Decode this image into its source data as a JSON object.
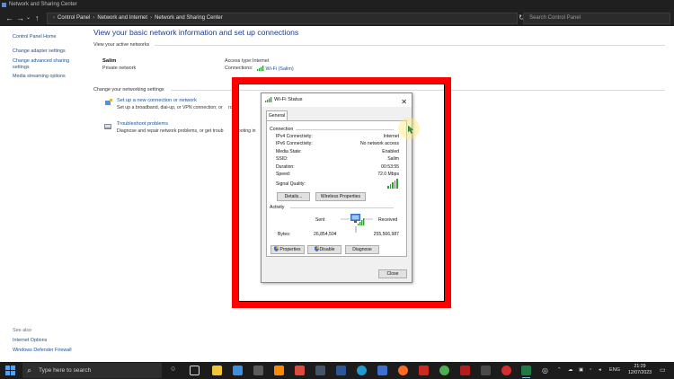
{
  "window": {
    "title": "Network and Sharing Center"
  },
  "address_bar": {
    "crumbs": [
      "Control Panel",
      "Network and Internet",
      "Network and Sharing Center"
    ],
    "search_placeholder": "Search Control Panel"
  },
  "left_pane": {
    "items": [
      "Control Panel Home",
      "Change adapter settings",
      "Change advanced sharing settings",
      "Media streaming options"
    ],
    "see_also_label": "See also",
    "see_also": [
      "Internet Options",
      "Windows Defender Firewall"
    ]
  },
  "main": {
    "title": "View your basic network information and set up connections",
    "active_networks_label": "View your active networks",
    "network_name": "Salim",
    "network_type": "Private network",
    "access_type_label": "Access type:",
    "access_type_value": "Internet",
    "connections_label": "Connections:",
    "connections_value": "Wi-Fi (Salim)",
    "change_settings_label": "Change your networking settings",
    "tasks": [
      {
        "link": "Set up a new connection or network",
        "desc": "Set up a broadband, dial-up, or VPN connection; or"
      },
      {
        "link": "Troubleshoot problems",
        "desc": "Diagnose and repair network problems, or get troub"
      }
    ],
    "tasks_overflow": [
      "ro",
      "hooting in"
    ]
  },
  "dialog": {
    "title": "Wi-Fi Status",
    "close_glyph": "✕",
    "tab": "General",
    "connection_label": "Connection",
    "rows": [
      {
        "label": "IPv4 Connectivity:",
        "value": "Internet"
      },
      {
        "label": "IPv6 Connectivity:",
        "value": "No network access"
      },
      {
        "label": "Media State:",
        "value": "Enabled"
      },
      {
        "label": "SSID:",
        "value": "Salim"
      },
      {
        "label": "Duration:",
        "value": "00:53:55"
      },
      {
        "label": "Speed:",
        "value": "72.0 Mbps"
      }
    ],
    "signal_label": "Signal Quality:",
    "signal_bars_lit": 5,
    "details_button": "Details...",
    "wireless_props_button": "Wireless Properties",
    "activity_label": "Activity",
    "sent_label": "Sent",
    "received_label": "Received",
    "bytes_label": "Bytes:",
    "bytes_sent": "26,854,504",
    "bytes_received": "255,566,987",
    "properties_button": "Properties",
    "disable_button": "Disable",
    "diagnose_button": "Diagnose",
    "close_button": "Close"
  },
  "taskbar": {
    "search_placeholder": "Type here to search",
    "tray_lang": "ENG",
    "time": "21:29",
    "date": "12/07/2023"
  },
  "colors": {
    "highlight": "#ff0000",
    "link": "#1a4f97",
    "signal": "#2f9e3a"
  }
}
